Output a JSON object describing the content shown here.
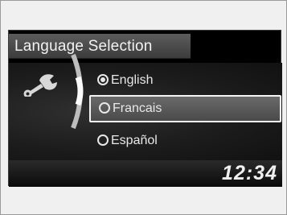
{
  "screen": {
    "title": "Language Selection",
    "icon": "wrench-icon",
    "options": [
      {
        "label": "English",
        "selected": true
      },
      {
        "label": "Francais",
        "selected": false,
        "highlighted": true
      },
      {
        "label": "Español",
        "selected": false
      }
    ],
    "clock": "12:34"
  },
  "colors": {
    "screen_bg": "#000000",
    "title_bar": "#4a4a4a",
    "highlight": "#5a5a5a",
    "text": "#e8e8e8"
  }
}
